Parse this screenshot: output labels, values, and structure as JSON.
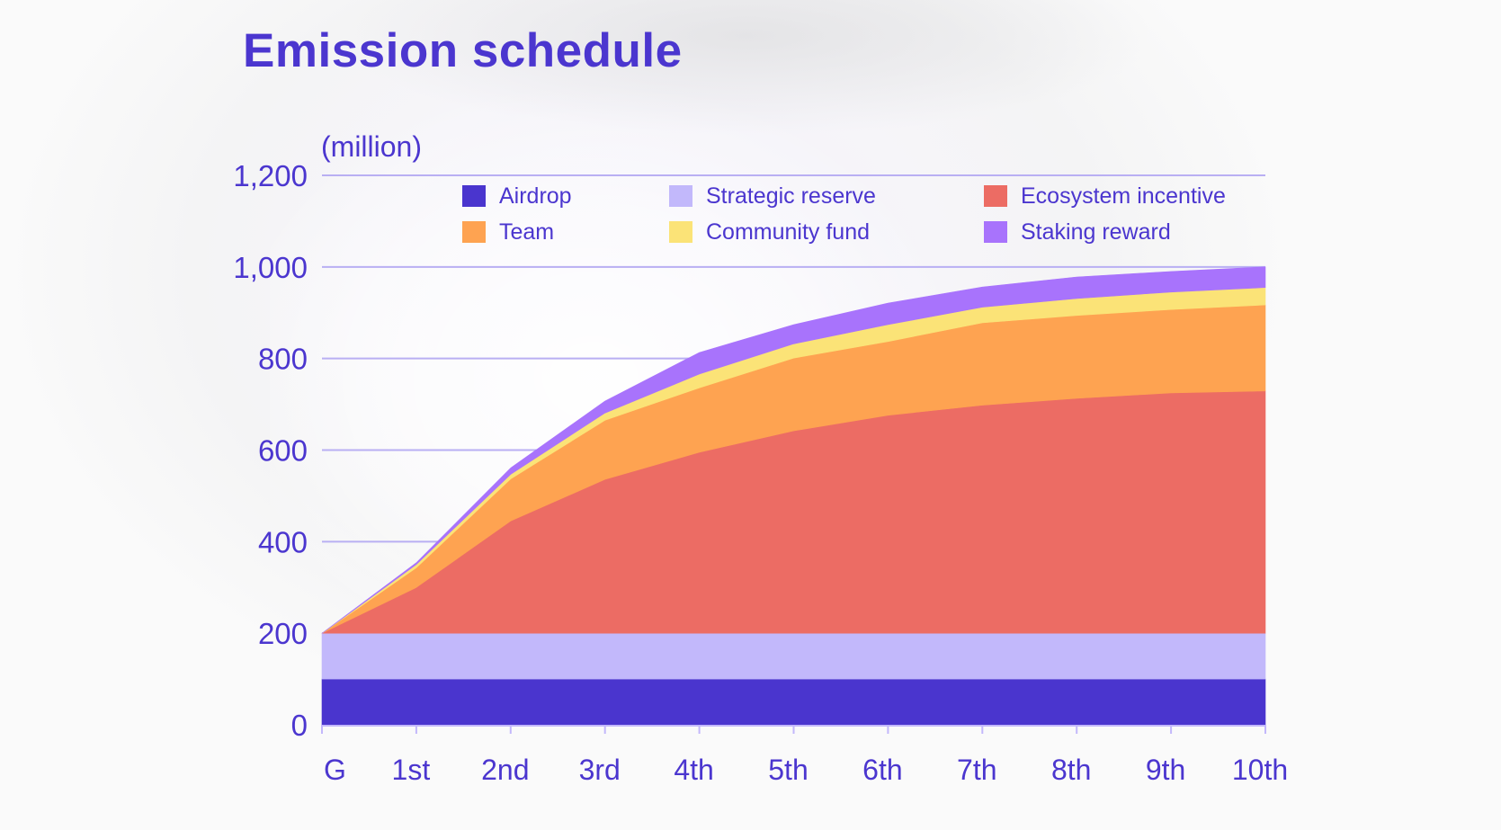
{
  "title": "Emission schedule",
  "unit_label": "(million)",
  "colors": {
    "text": "#4b36cf",
    "grid": "#b9aff3",
    "axis": "#c3b8fb"
  },
  "chart_data": {
    "type": "area",
    "stacked": true,
    "title": "Emission schedule",
    "xlabel": "",
    "ylabel": "(million)",
    "categories": [
      "G",
      "1st",
      "2nd",
      "3rd",
      "4th",
      "5th",
      "6th",
      "7th",
      "8th",
      "9th",
      "10th"
    ],
    "ylim": [
      0,
      1200
    ],
    "yticks": [
      0,
      200,
      400,
      600,
      800,
      1000,
      1200
    ],
    "ytick_labels": [
      "0",
      "200",
      "400",
      "600",
      "800",
      "1,000",
      "1,200"
    ],
    "grid": true,
    "legend_position": "top",
    "series": [
      {
        "name": "Airdrop",
        "color": "#4a35ce",
        "values": [
          100,
          100,
          100,
          100,
          100,
          100,
          100,
          100,
          100,
          100,
          100
        ]
      },
      {
        "name": "Strategic reserve",
        "color": "#c2b8fb",
        "values": [
          100,
          100,
          100,
          100,
          100,
          100,
          100,
          100,
          100,
          100,
          100
        ]
      },
      {
        "name": "Ecosystem incentive",
        "color": "#ec6c64",
        "values": [
          0,
          100,
          245,
          336,
          395,
          442,
          476,
          498,
          513,
          525,
          529
        ]
      },
      {
        "name": "Team",
        "color": "#fea351",
        "values": [
          0,
          43,
          92,
          129,
          141,
          159,
          161,
          180,
          181,
          182,
          188
        ]
      },
      {
        "name": "Community fund",
        "color": "#fbe377",
        "values": [
          0,
          7,
          10,
          16,
          30,
          31,
          37,
          34,
          37,
          38,
          38
        ]
      },
      {
        "name": "Staking reward",
        "color": "#a873fc",
        "values": [
          0,
          4,
          14,
          26,
          47,
          42,
          47,
          44,
          47,
          45,
          45
        ]
      }
    ]
  },
  "legend": [
    {
      "label": "Airdrop",
      "color": "#4a35ce"
    },
    {
      "label": "Strategic reserve",
      "color": "#c2b8fb"
    },
    {
      "label": "Ecosystem incentive",
      "color": "#ec6c64"
    },
    {
      "label": "Team",
      "color": "#fea351"
    },
    {
      "label": "Community fund",
      "color": "#fbe377"
    },
    {
      "label": "Staking reward",
      "color": "#a873fc"
    }
  ]
}
